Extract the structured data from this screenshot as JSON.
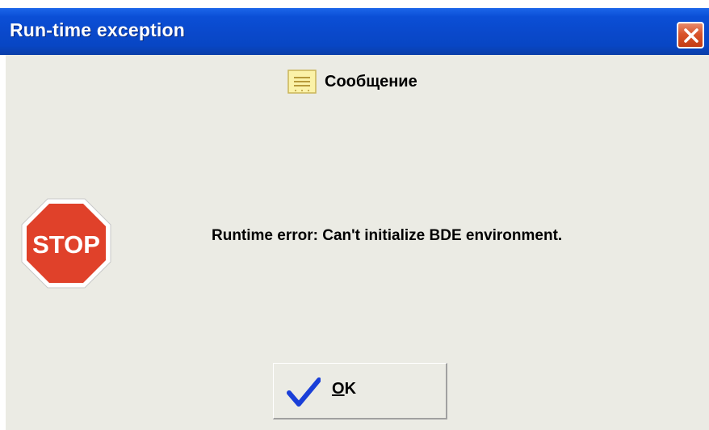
{
  "window": {
    "title": "Run-time exception"
  },
  "message": {
    "header_label": "Сообщение",
    "header_icon": "message-icon",
    "stop_icon_text": "STOP",
    "error_text": "Runtime error: Can't initialize BDE environment."
  },
  "buttons": {
    "ok": {
      "mnemonic": "O",
      "rest": "K",
      "icon": "checkmark-icon"
    }
  },
  "colors": {
    "titlebar": "#0b4fd6",
    "close_button": "#d9542b",
    "stop": "#e0412a",
    "check": "#1a3fd8",
    "dialog_bg": "#ebebe4"
  }
}
